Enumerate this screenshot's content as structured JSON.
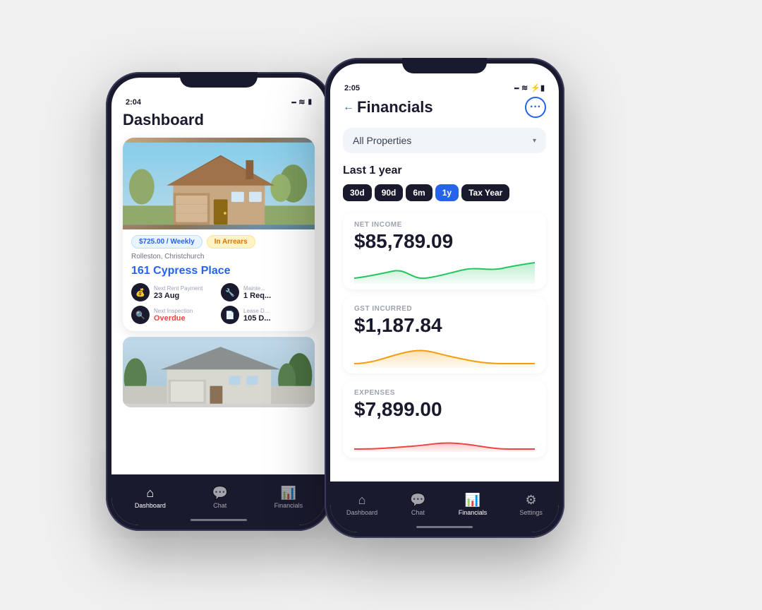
{
  "scene": {
    "background": "#f0f0f0"
  },
  "phone1": {
    "status": {
      "time": "2:04",
      "signal": "●●●",
      "wifi": "WiFi",
      "battery": "🔋"
    },
    "title": "Dashboard",
    "property": {
      "price_badge": "$725.00 / Weekly",
      "status_badge": "In Arrears",
      "address": "Rolleston, Christchurch",
      "name": "161 Cypress Place",
      "stats": [
        {
          "icon": "💰",
          "label": "Next Rent Payment",
          "value": "23 Aug"
        },
        {
          "icon": "🔧",
          "label": "Mainten...",
          "value": "1 Req..."
        },
        {
          "icon": "🔍",
          "label": "Next Inspection",
          "value": "Overdue"
        },
        {
          "icon": "📄",
          "label": "Lease D...",
          "value": "105 D..."
        }
      ]
    },
    "nav": [
      {
        "icon": "⌂",
        "label": "Dashboard",
        "active": true
      },
      {
        "icon": "💬",
        "label": "Chat",
        "active": false
      },
      {
        "icon": "📊",
        "label": "Financials",
        "active": false
      }
    ]
  },
  "phone2": {
    "status": {
      "time": "2:05",
      "signal": "●●●",
      "wifi": "WiFi",
      "battery": "⚡"
    },
    "back_label": "Back",
    "title": "Financials",
    "more_icon": "•••",
    "property_selector": "All Properties",
    "period_label": "Last 1 year",
    "tabs": [
      {
        "label": "30d",
        "active": false
      },
      {
        "label": "90d",
        "active": false
      },
      {
        "label": "6m",
        "active": false
      },
      {
        "label": "1y",
        "active": true
      },
      {
        "label": "Tax Year",
        "active": false
      }
    ],
    "metrics": [
      {
        "label": "NET INCOME",
        "value": "$85,789.09",
        "chart_color": "#22c55e",
        "chart_type": "income"
      },
      {
        "label": "GST INCURRED",
        "value": "$1,187.84",
        "chart_color": "#f59e0b",
        "chart_type": "gst"
      },
      {
        "label": "EXPENSES",
        "value": "$7,899.00",
        "chart_color": "#ef4444",
        "chart_type": "expenses"
      }
    ],
    "nav": [
      {
        "icon": "⌂",
        "label": "Dashboard",
        "active": false
      },
      {
        "icon": "💬",
        "label": "Chat",
        "active": false
      },
      {
        "icon": "📊",
        "label": "Financials",
        "active": true
      },
      {
        "icon": "⚙",
        "label": "Settings",
        "active": false
      }
    ]
  }
}
